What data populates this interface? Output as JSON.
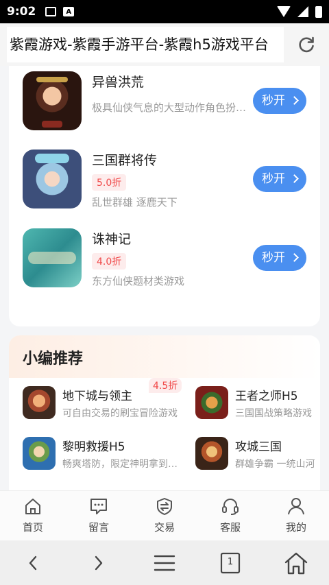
{
  "status_bar": {
    "time": "9:02",
    "icons": [
      "image-icon",
      "a-icon",
      "wifi-icon",
      "signal-icon",
      "battery-icon"
    ]
  },
  "title_bar": {
    "title": "紫霞游戏-紫霞手游平台-紫霞h5游戏平台",
    "refresh_icon": "refresh-icon"
  },
  "game_list": [
    {
      "name": "异兽洪荒",
      "tag": "",
      "desc": "极具仙侠气息的大型动作角色扮演游戏",
      "button": "秒开"
    },
    {
      "name": "三国群将传",
      "tag": "5.0折",
      "desc": "乱世群雄 逐鹿天下",
      "button": "秒开"
    },
    {
      "name": "诛神记",
      "tag": "4.0折",
      "desc": "东方仙侠题材类游戏",
      "button": "秒开"
    }
  ],
  "recommend": {
    "title": "小编推荐",
    "items": [
      {
        "name": "地下城与领主",
        "desc": "可自由交易的刷宝冒险游戏",
        "discount": "4.5折"
      },
      {
        "name": "王者之师H5",
        "desc": "三国国战策略游戏",
        "discount": ""
      },
      {
        "name": "黎明救援H5",
        "desc": "畅爽塔防，限定神明拿到手软",
        "discount": ""
      },
      {
        "name": "攻城三国",
        "desc": "群雄争霸 一统山河",
        "discount": ""
      }
    ]
  },
  "tabs": [
    {
      "label": "首页",
      "icon": "home-icon"
    },
    {
      "label": "留言",
      "icon": "message-icon"
    },
    {
      "label": "交易",
      "icon": "trade-icon"
    },
    {
      "label": "客服",
      "icon": "headset-icon"
    },
    {
      "label": "我的",
      "icon": "user-icon"
    }
  ],
  "browser_nav": {
    "tab_count": "1"
  },
  "colors": {
    "accent": "#4a8ff0",
    "discount": "#f04848",
    "discount_bg": "#fdecec"
  }
}
